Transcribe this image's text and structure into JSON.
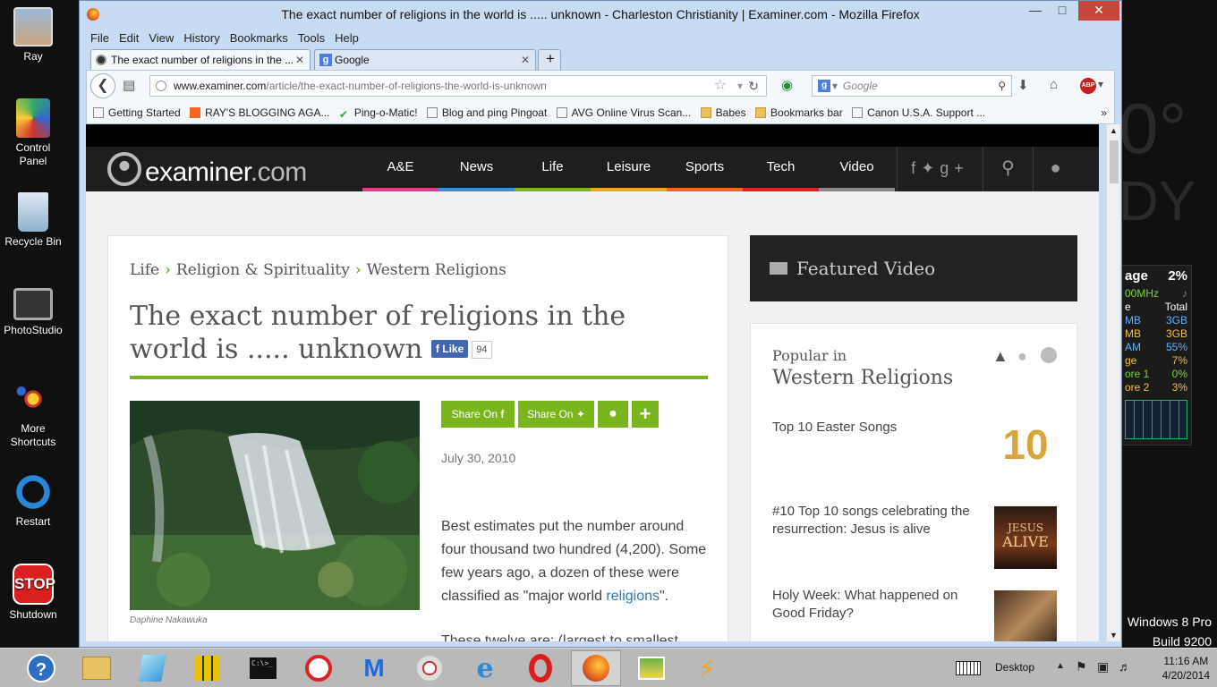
{
  "desktop": {
    "icons": [
      {
        "label": "Ray"
      },
      {
        "label": "Control\nPanel"
      },
      {
        "label": "Recycle Bin"
      },
      {
        "label": "PhotoStudio"
      },
      {
        "label": "More\nShortcuts"
      },
      {
        "label": "Restart"
      },
      {
        "label": "Shutdown"
      }
    ],
    "weather_temp": "0°",
    "weather_cond": "DY",
    "cpu_gadget": {
      "header_label": "age",
      "header_value": "2%",
      "freq": "00MHz",
      "col1": "e",
      "col2": "Total",
      "rows": [
        {
          "a": "MB",
          "b": "3GB"
        },
        {
          "a": "MB",
          "b": "3GB"
        },
        {
          "a": "AM",
          "b": "55%"
        },
        {
          "a": "ge",
          "b": "7%"
        },
        {
          "a": "ore 1",
          "b": "0%"
        },
        {
          "a": "ore 2",
          "b": "3%"
        }
      ]
    },
    "os_name": "Windows 8 Pro",
    "os_build": "Build 9200"
  },
  "window": {
    "title": "The exact number of religions in the world is ..... unknown - Charleston Christianity | Examiner.com - Mozilla Firefox",
    "menu": [
      "File",
      "Edit",
      "View",
      "History",
      "Bookmarks",
      "Tools",
      "Help"
    ],
    "tabs": [
      {
        "label": "The exact number of religions in the ..."
      },
      {
        "label": "Google"
      }
    ],
    "url_domain": "www.examiner.com",
    "url_path": "/article/the-exact-number-of-religions-the-world-is-unknown",
    "search_placeholder": "Google",
    "bookmarks": [
      "Getting Started",
      "RAY'S BLOGGING AGA...",
      "Ping-o-Matic!",
      "Blog and ping  Pingoat",
      "AVG Online Virus Scan...",
      "Babes",
      "Bookmarks bar",
      "Canon U.S.A.  Support ..."
    ]
  },
  "site": {
    "logo_main": "examiner",
    "logo_tld": ".com",
    "nav": [
      {
        "label": "A&E",
        "color": "#e8388a"
      },
      {
        "label": "News",
        "color": "#3a8fd9"
      },
      {
        "label": "Life",
        "color": "#7ab51d"
      },
      {
        "label": "Leisure",
        "color": "#f0a81c"
      },
      {
        "label": "Sports",
        "color": "#f26522"
      },
      {
        "label": "Tech",
        "color": "#e02020"
      },
      {
        "label": "Video",
        "color": "#888888"
      }
    ],
    "breadcrumb": [
      "Life",
      "Religion & Spirituality",
      "Western Religions"
    ],
    "title": "The exact number of religions in the world is ..... unknown",
    "fb_like": "Like",
    "fb_count": "94",
    "share_fb": "Share On",
    "share_tw": "Share On",
    "date": "July 30, 2010",
    "photo_caption": "Daphine Nakawuka",
    "body_text": "Best estimates put the number around four thousand two hundred (4,200). Some few years ago, a dozen of these were classified as \"major world ",
    "body_link": "religions",
    "body_end": "\".",
    "body_next": "These twelve are: (largest to smallest",
    "featured_video": "Featured Video",
    "popular_label": "Popular in",
    "popular_section": "Western Religions",
    "popular_items": [
      {
        "title": "Top 10 Easter Songs"
      },
      {
        "title": "#10 Top 10 songs celebrating the resurrection: Jesus is alive"
      },
      {
        "title": "Holy Week: What happened on Good Friday?"
      }
    ],
    "thumb_10": "10",
    "thumb_jesus": "JESUS",
    "thumb_alive": "ALIVE"
  },
  "taskbar": {
    "desktop_label": "Desktop",
    "time": "11:16 AM",
    "date": "4/20/2014"
  }
}
